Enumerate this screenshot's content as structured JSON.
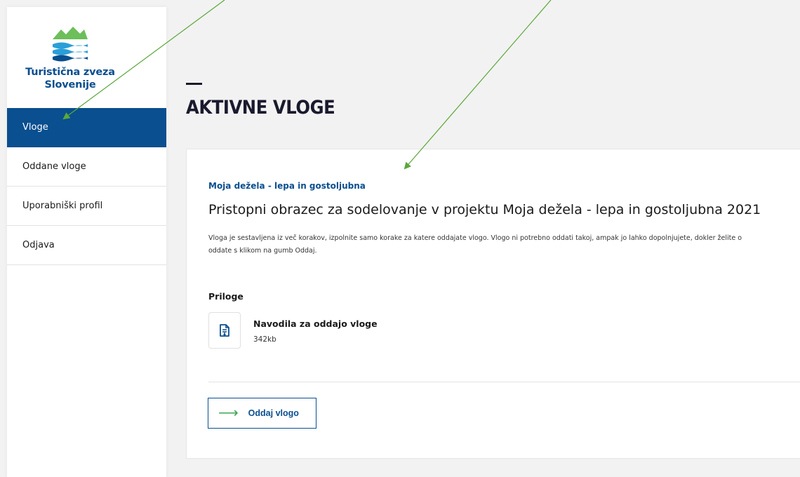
{
  "brand": {
    "name_line1": "Turistična zveza",
    "name_line2": "Slovenije",
    "colors": {
      "primary": "#0a4f8f",
      "mountain": "#6cbf5a",
      "wave": "#2a9fd8",
      "accent_arrow": "#3aa652"
    }
  },
  "sidebar": {
    "items": [
      {
        "label": "Vloge",
        "active": true
      },
      {
        "label": "Oddane vloge",
        "active": false
      },
      {
        "label": "Uporabniški profil",
        "active": false
      },
      {
        "label": "Odjava",
        "active": false
      }
    ]
  },
  "page": {
    "title": "AKTIVNE VLOGE"
  },
  "application": {
    "category": "Moja dežela - lepa in gostoljubna",
    "title": "Pristopni obrazec za sodelovanje v projektu Moja dežela - lepa in gostoljubna 2021",
    "description_line1": "Vloga je sestavljena iz več korakov, izpolnite samo korake za katere oddajate vlogo. Vlogo ni potrebno oddati takoj, ampak jo lahko dopolnjujete, dokler želite o",
    "description_line2": "oddate s klikom na gumb Oddaj.",
    "attachments_heading": "Priloge",
    "attachment": {
      "name": "Navodila za oddajo vloge",
      "size": "342kb",
      "icon": "file-download-icon"
    },
    "submit_label": "Oddaj vlogo",
    "submit_icon": "arrow-right-icon"
  },
  "annotations": {
    "color": "#5aa83a"
  }
}
